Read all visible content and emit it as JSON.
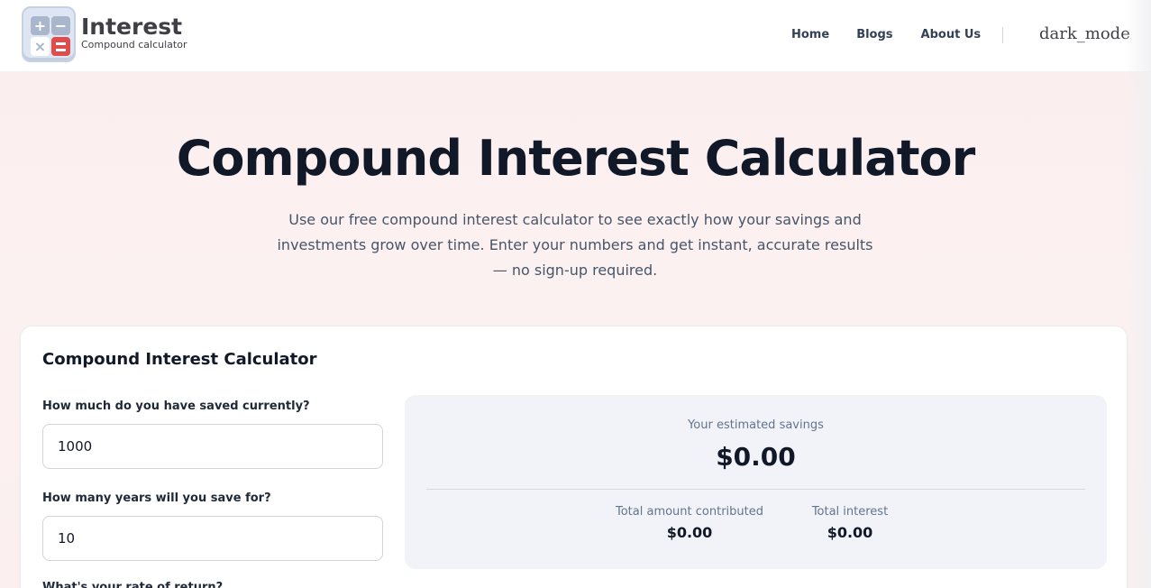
{
  "header": {
    "logo": {
      "title": "Interest",
      "subtitle": "Compound calculator"
    },
    "nav": [
      "Home",
      "Blogs",
      "About Us"
    ],
    "theme_toggle": "dark_mode"
  },
  "hero": {
    "title": "Compound Interest Calculator",
    "description": "Use our free compound interest calculator to see exactly how your savings and investments grow over time. Enter your numbers and get instant, accurate results — no sign-up required."
  },
  "calculator": {
    "title": "Compound Interest Calculator",
    "fields": [
      {
        "label": "How much do you have saved currently?",
        "value": "1000"
      },
      {
        "label": "How many years will you save for?",
        "value": "10"
      },
      {
        "label": "What's your rate of return?",
        "value": ""
      }
    ],
    "results": {
      "estimated_label": "Your estimated savings",
      "estimated_value": "$0.00",
      "contributed_label": "Total amount contributed",
      "contributed_value": "$0.00",
      "interest_label": "Total interest",
      "interest_value": "$0.00"
    }
  },
  "colors": {
    "hero_background": "#fbeeee",
    "results_background": "#f1f3f8",
    "logo_accent": "#e04b4b"
  }
}
